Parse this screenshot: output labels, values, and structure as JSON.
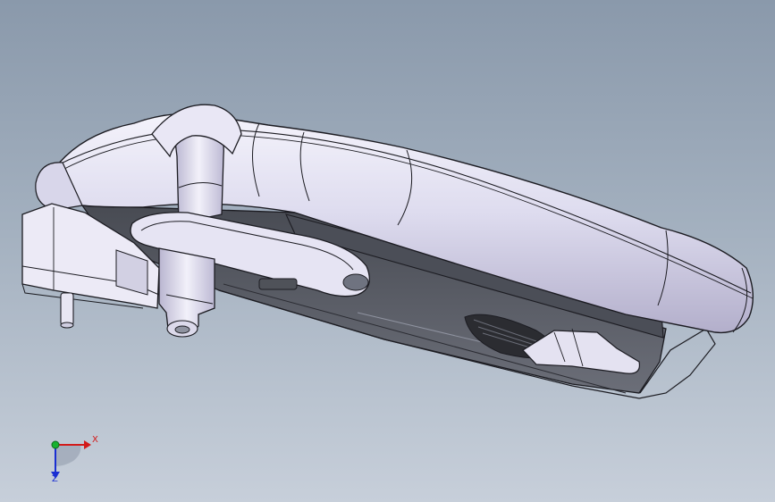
{
  "viewport": {
    "background_top": "#8a99ab",
    "background_bottom": "#c7cfda"
  },
  "model": {
    "shell_color": "#e4e2f3",
    "shell_shadow": "#b5b2cc",
    "edge_color": "#1c1c22",
    "base_plate_color": "#5a5d66"
  },
  "triad": {
    "x_label": "X",
    "z_label": "Z",
    "x_color": "#d21a1a",
    "y_color": "#17b22f",
    "z_color": "#1a2fd2"
  }
}
